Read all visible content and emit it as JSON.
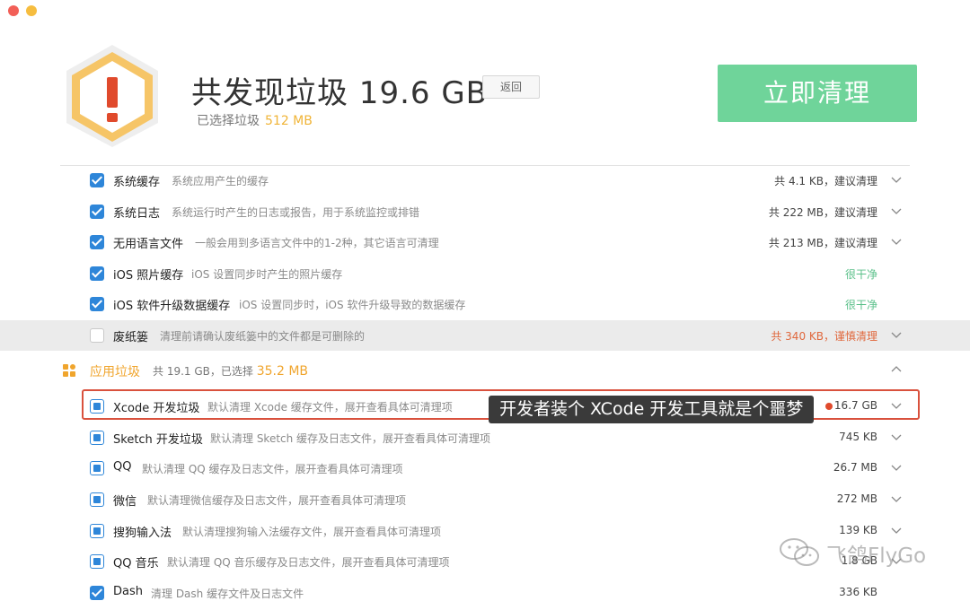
{
  "header": {
    "title": "共发现垃圾 19.6 GB",
    "back_label": "返回",
    "selected_label": "已选择垃圾",
    "selected_amount": "512 MB",
    "clean_label": "立即清理"
  },
  "system_rows": [
    {
      "name": "系统缓存",
      "desc": "系统应用产生的缓存",
      "size": "共 4.1 KB，建议清理"
    },
    {
      "name": "系统日志",
      "desc": "系统运行时产生的日志或报告，用于系统监控或排错",
      "size": "共 222 MB，建议清理"
    },
    {
      "name": "无用语言文件",
      "desc": "一般会用到多语言文件中的1-2种，其它语言可清理",
      "size": "共 213 MB，建议清理"
    },
    {
      "name": "iOS 照片缓存",
      "desc": "iOS 设置同步时产生的照片缓存",
      "size": "很干净"
    },
    {
      "name": "iOS 软件升级数据缓存",
      "desc": "iOS 设置同步时，iOS 软件升级导致的数据缓存",
      "size": "很干净"
    },
    {
      "name": "废纸篓",
      "desc": "清理前请确认废纸篓中的文件都是可删除的",
      "size": "共 340 KB，谨慎清理"
    }
  ],
  "app_section": {
    "title": "应用垃圾",
    "meta": "共 19.1 GB，已选择",
    "selected": "35.2 MB"
  },
  "app_rows": [
    {
      "name": "Xcode 开发垃圾",
      "desc": "默认清理 Xcode 缓存文件，展开查看具体可清理项",
      "size": "16.7 GB"
    },
    {
      "name": "Sketch 开发垃圾",
      "desc": "默认清理 Sketch 缓存及日志文件，展开查看具体可清理项",
      "size": "745 KB"
    },
    {
      "name": "QQ",
      "desc": "默认清理 QQ 缓存及日志文件，展开查看具体可清理项",
      "size": "26.7 MB"
    },
    {
      "name": "微信",
      "desc": "默认清理微信缓存及日志文件，展开查看具体可清理项",
      "size": "272 MB"
    },
    {
      "name": "搜狗输入法",
      "desc": "默认清理搜狗输入法缓存文件，展开查看具体可清理项",
      "size": "139 KB"
    },
    {
      "name": "QQ 音乐",
      "desc": "默认清理 QQ 音乐缓存及日志文件，展开查看具体可清理项",
      "size": "1.8 GB"
    },
    {
      "name": "Dash",
      "desc": "清理 Dash 缓存文件及日志文件",
      "size": "336 KB"
    }
  ],
  "annotation": {
    "tooltip": "开发者装个 XCode 开发工具就是个噩梦"
  },
  "watermark": {
    "text": "飞鸽FlyGo"
  },
  "colors": {
    "accent_green": "#6fd49a",
    "checkbox_blue": "#2e86d9",
    "warning_orange": "#f0a52d",
    "danger": "#e0683d"
  }
}
